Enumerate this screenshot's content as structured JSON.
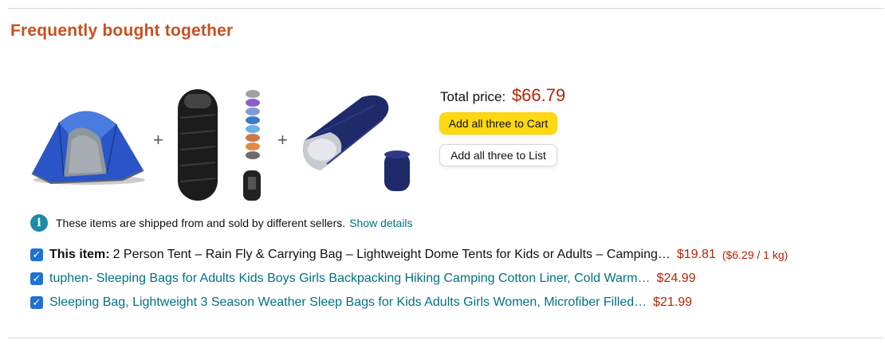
{
  "section_title": "Frequently bought together",
  "plus_sign": "+",
  "products_images": [
    {
      "name": "dome tent",
      "color": "#2a55c8"
    },
    {
      "name": "black sleeping bag with color swatches",
      "color": "#222222"
    },
    {
      "name": "navy sleeping bag",
      "color": "#1f2a6b"
    }
  ],
  "total": {
    "label": "Total price:",
    "amount": "$66.79"
  },
  "buttons": {
    "add_cart": "Add all three to Cart",
    "add_list": "Add all three to List"
  },
  "info": {
    "icon": "i",
    "text": "These items are shipped from and sold by different sellers.",
    "link": "Show details"
  },
  "items": [
    {
      "checked": true,
      "prefix": "This item:",
      "title": "2 Person Tent – Rain Fly & Carrying Bag – Lightweight Dome Tents for Kids or Adults – Camping…",
      "price": "$19.81",
      "unit_price": "($6.29 / 1 kg)"
    },
    {
      "checked": true,
      "title": "tuphen- Sleeping Bags for Adults Kids Boys Girls Backpacking Hiking Camping Cotton Liner, Cold Warm…",
      "price": "$24.99"
    },
    {
      "checked": true,
      "title": "Sleeping Bag, Lightweight 3 Season Weather Sleep Bags for Kids Adults Girls Women, Microfiber Filled…",
      "price": "$21.99"
    }
  ],
  "colors": {
    "title_orange": "#c7511f",
    "price_red": "#b12704",
    "link_teal": "#007185",
    "cart_yellow": "#ffd814",
    "checkbox_blue": "#1f72d1"
  }
}
